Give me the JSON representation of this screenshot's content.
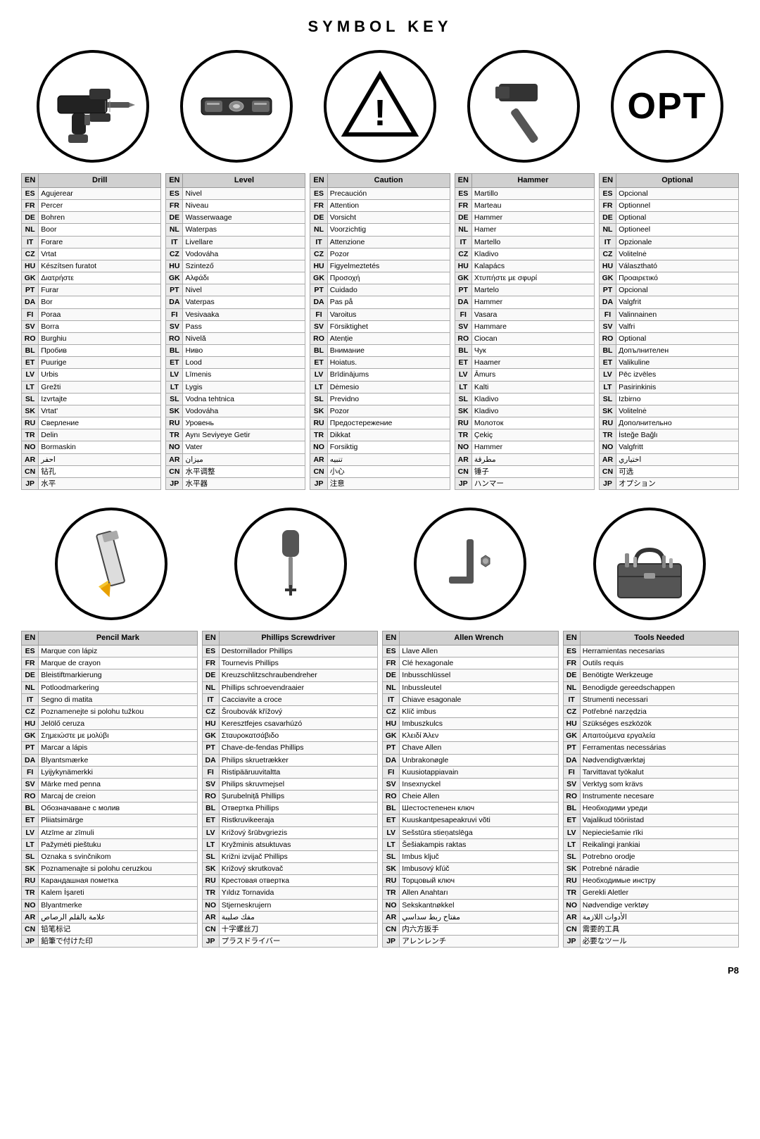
{
  "title": "SYMBOL KEY",
  "page_number": "P8",
  "icons_row1": [
    {
      "name": "Drill",
      "shape": "drill"
    },
    {
      "name": "Level",
      "shape": "level"
    },
    {
      "name": "Caution",
      "shape": "caution"
    },
    {
      "name": "Hammer",
      "shape": "hammer"
    },
    {
      "name": "Optional",
      "shape": "opt"
    }
  ],
  "icons_row2": [
    {
      "name": "Pencil Mark",
      "shape": "pencil"
    },
    {
      "name": "Phillips Screwdriver",
      "shape": "phillips"
    },
    {
      "name": "Allen Wrench",
      "shape": "allen"
    },
    {
      "name": "Tools Needed",
      "shape": "toolbox"
    }
  ],
  "tables": [
    {
      "id": "drill",
      "header": [
        "EN",
        "Drill"
      ],
      "rows": [
        [
          "ES",
          "Agujerear"
        ],
        [
          "FR",
          "Percer"
        ],
        [
          "DE",
          "Bohren"
        ],
        [
          "NL",
          "Boor"
        ],
        [
          "IT",
          "Forare"
        ],
        [
          "CZ",
          "Vrtat"
        ],
        [
          "HU",
          "Készítsen furatot"
        ],
        [
          "GK",
          "Διατρήστε"
        ],
        [
          "PT",
          "Furar"
        ],
        [
          "DA",
          "Bor"
        ],
        [
          "FI",
          "Poraa"
        ],
        [
          "SV",
          "Borra"
        ],
        [
          "RO",
          "Burghiu"
        ],
        [
          "BL",
          "Пробив"
        ],
        [
          "ET",
          "Puurige"
        ],
        [
          "LV",
          "Urbis"
        ],
        [
          "LT",
          "Grežti"
        ],
        [
          "SL",
          "Izvrtajte"
        ],
        [
          "SK",
          "Vrtat'"
        ],
        [
          "RU",
          "Сверление"
        ],
        [
          "TR",
          "Delin"
        ],
        [
          "NO",
          "Bormaskin"
        ],
        [
          "AR",
          "احفر"
        ],
        [
          "CN",
          "钻孔"
        ],
        [
          "JP",
          "水平"
        ]
      ]
    },
    {
      "id": "level",
      "header": [
        "EN",
        "Level"
      ],
      "rows": [
        [
          "ES",
          "Nivel"
        ],
        [
          "FR",
          "Niveau"
        ],
        [
          "DE",
          "Wasserwaage"
        ],
        [
          "NL",
          "Waterpas"
        ],
        [
          "IT",
          "Livellare"
        ],
        [
          "CZ",
          "Vodováha"
        ],
        [
          "HU",
          "Szintező"
        ],
        [
          "GK",
          "Αλφάδι"
        ],
        [
          "PT",
          "Nivel"
        ],
        [
          "DA",
          "Vaterpas"
        ],
        [
          "FI",
          "Vesivaaka"
        ],
        [
          "SV",
          "Pass"
        ],
        [
          "RO",
          "Nivelă"
        ],
        [
          "BL",
          "Ниво"
        ],
        [
          "ET",
          "Lood"
        ],
        [
          "LV",
          "Līmenis"
        ],
        [
          "LT",
          "Lygis"
        ],
        [
          "SL",
          "Vodna tehtnica"
        ],
        [
          "SK",
          "Vodováha"
        ],
        [
          "RU",
          "Уровень"
        ],
        [
          "TR",
          "Aynı Seviyeye Getir"
        ],
        [
          "NO",
          "Vater"
        ],
        [
          "AR",
          "ميزان"
        ],
        [
          "CN",
          "水平调整"
        ],
        [
          "JP",
          "水平器"
        ]
      ]
    },
    {
      "id": "caution",
      "header": [
        "EN",
        "Caution"
      ],
      "rows": [
        [
          "ES",
          "Precaución"
        ],
        [
          "FR",
          "Attention"
        ],
        [
          "DE",
          "Vorsicht"
        ],
        [
          "NL",
          "Voorzichtig"
        ],
        [
          "IT",
          "Attenzione"
        ],
        [
          "CZ",
          "Pozor"
        ],
        [
          "HU",
          "Figyelmeztetés"
        ],
        [
          "GK",
          "Προσοχή"
        ],
        [
          "PT",
          "Cuidado"
        ],
        [
          "DA",
          "Pas på"
        ],
        [
          "FI",
          "Varoitus"
        ],
        [
          "SV",
          "Försiktighet"
        ],
        [
          "RO",
          "Atenție"
        ],
        [
          "BL",
          "Внимание"
        ],
        [
          "ET",
          "Hoiatus."
        ],
        [
          "LV",
          "Brīdinājums"
        ],
        [
          "LT",
          "Dėmesio"
        ],
        [
          "SL",
          "Previdno"
        ],
        [
          "SK",
          "Pozor"
        ],
        [
          "RU",
          "Предостережение"
        ],
        [
          "TR",
          "Dikkat"
        ],
        [
          "NO",
          "Forsiktig"
        ],
        [
          "AR",
          "تنبيه"
        ],
        [
          "CN",
          "小心"
        ],
        [
          "JP",
          "注意"
        ]
      ]
    },
    {
      "id": "hammer",
      "header": [
        "EN",
        "Hammer"
      ],
      "rows": [
        [
          "ES",
          "Martillo"
        ],
        [
          "FR",
          "Marteau"
        ],
        [
          "DE",
          "Hammer"
        ],
        [
          "NL",
          "Hamer"
        ],
        [
          "IT",
          "Martello"
        ],
        [
          "CZ",
          "Kladivo"
        ],
        [
          "HU",
          "Kalapács"
        ],
        [
          "GK",
          "Χτυπήστε με σφυρί"
        ],
        [
          "PT",
          "Martelo"
        ],
        [
          "DA",
          "Hammer"
        ],
        [
          "FI",
          "Vasara"
        ],
        [
          "SV",
          "Hammare"
        ],
        [
          "RO",
          "Ciocan"
        ],
        [
          "BL",
          "Чук"
        ],
        [
          "ET",
          "Haamer"
        ],
        [
          "LV",
          "Āmurs"
        ],
        [
          "LT",
          "Kalti"
        ],
        [
          "SL",
          "Kladivo"
        ],
        [
          "SK",
          "Kladivo"
        ],
        [
          "RU",
          "Молоток"
        ],
        [
          "TR",
          "Çekiç"
        ],
        [
          "NO",
          "Hammer"
        ],
        [
          "AR",
          "مطرقة"
        ],
        [
          "CN",
          "锤子"
        ],
        [
          "JP",
          "ハンマー"
        ]
      ]
    },
    {
      "id": "optional",
      "header": [
        "EN",
        "Optional"
      ],
      "rows": [
        [
          "ES",
          "Opcional"
        ],
        [
          "FR",
          "Optionnel"
        ],
        [
          "DE",
          "Optional"
        ],
        [
          "NL",
          "Optioneel"
        ],
        [
          "IT",
          "Opzionale"
        ],
        [
          "CZ",
          "Volitelnė"
        ],
        [
          "HU",
          "Választható"
        ],
        [
          "GK",
          "Προαιρετικό"
        ],
        [
          "PT",
          "Opcional"
        ],
        [
          "DA",
          "Valgfrit"
        ],
        [
          "FI",
          "Valinnainen"
        ],
        [
          "SV",
          "Valfri"
        ],
        [
          "RO",
          "Optional"
        ],
        [
          "BL",
          "Допълнителен"
        ],
        [
          "ET",
          "Valikuline"
        ],
        [
          "LV",
          "Pēc izvēles"
        ],
        [
          "LT",
          "Pasirinkinis"
        ],
        [
          "SL",
          "Izbirno"
        ],
        [
          "SK",
          "Volitelnė"
        ],
        [
          "RU",
          "Дополнительно"
        ],
        [
          "TR",
          "İsteğe Bağlı"
        ],
        [
          "NO",
          "Valgfritt"
        ],
        [
          "AR",
          "اختياري"
        ],
        [
          "CN",
          "可选"
        ],
        [
          "JP",
          "オプション"
        ]
      ]
    },
    {
      "id": "pencil",
      "header": [
        "EN",
        "Pencil Mark"
      ],
      "rows": [
        [
          "ES",
          "Marque con lápiz"
        ],
        [
          "FR",
          "Marque de crayon"
        ],
        [
          "DE",
          "Bleistiftmarkierung"
        ],
        [
          "NL",
          "Potloodmarkering"
        ],
        [
          "IT",
          "Segno di matita"
        ],
        [
          "CZ",
          "Poznamenejte si polohu tužkou"
        ],
        [
          "HU",
          "Jelölő ceruza"
        ],
        [
          "GK",
          "Σημειώστε με μολύβι"
        ],
        [
          "PT",
          "Marcar a lápis"
        ],
        [
          "DA",
          "Blyantsmærke"
        ],
        [
          "FI",
          "Lyijykynämerkki"
        ],
        [
          "SV",
          "Märke med penna"
        ],
        [
          "RO",
          "Marcaj de creion"
        ],
        [
          "BL",
          "Обозначаване с молив"
        ],
        [
          "ET",
          "Pliiatsimärge"
        ],
        [
          "LV",
          "Atzīme ar zīmuli"
        ],
        [
          "LT",
          "Pažymėti pieštuku"
        ],
        [
          "SL",
          "Oznaka s svinčnikom"
        ],
        [
          "SK",
          "Poznamenajte si polohu ceruzkou"
        ],
        [
          "RU",
          "Карандашная пометка"
        ],
        [
          "TR",
          "Kalem İşareti"
        ],
        [
          "NO",
          "Blyantmerke"
        ],
        [
          "AR",
          "علامة بالقلم الرصاص"
        ],
        [
          "CN",
          "铅笔标记"
        ],
        [
          "JP",
          "鉛筆で付けた印"
        ]
      ]
    },
    {
      "id": "phillips",
      "header": [
        "EN",
        "Phillips Screwdriver"
      ],
      "rows": [
        [
          "ES",
          "Destornillador Phillips"
        ],
        [
          "FR",
          "Tournevis Phillips"
        ],
        [
          "DE",
          "Kreuzschlitzschraubendreher"
        ],
        [
          "NL",
          "Phillips schroevendraaier"
        ],
        [
          "IT",
          "Cacciavite a croce"
        ],
        [
          "CZ",
          "Šroubovák křížový"
        ],
        [
          "HU",
          "Keresztfejes csavarhúzó"
        ],
        [
          "GK",
          "Σταυροκατσάβιδο"
        ],
        [
          "PT",
          "Chave-de-fendas Phillips"
        ],
        [
          "DA",
          "Philips skruetrækker"
        ],
        [
          "FI",
          "Ristipääruuvitaltta"
        ],
        [
          "SV",
          "Philips skruvmejsel"
        ],
        [
          "RO",
          "Șurubelniță Phillips"
        ],
        [
          "BL",
          "Отвертка Phillips"
        ],
        [
          "ET",
          "Ristkruvikeeraja"
        ],
        [
          "LV",
          "Križový šrūbvgriezis"
        ],
        [
          "LT",
          "Kryžminis atsuktuvas"
        ],
        [
          "SL",
          "Križni izvijač Phillips"
        ],
        [
          "SK",
          "Križový skrutkovač"
        ],
        [
          "RU",
          "Крестовая отвертка"
        ],
        [
          "TR",
          "Yıldız Tornavida"
        ],
        [
          "NO",
          "Stjerneskrujern"
        ],
        [
          "AR",
          "مفك صليبة"
        ],
        [
          "CN",
          "十字螺丝刀"
        ],
        [
          "JP",
          "プラスドライバー"
        ]
      ]
    },
    {
      "id": "allen",
      "header": [
        "EN",
        "Allen Wrench"
      ],
      "rows": [
        [
          "ES",
          "Llave Allen"
        ],
        [
          "FR",
          "Clé hexagonale"
        ],
        [
          "DE",
          "Inbusschlüssel"
        ],
        [
          "NL",
          "Inbussleutel"
        ],
        [
          "IT",
          "Chiave esagonale"
        ],
        [
          "CZ",
          "Klíč imbus"
        ],
        [
          "HU",
          "Imbuszkulcs"
        ],
        [
          "GK",
          "Κλειδί Άλεν"
        ],
        [
          "PT",
          "Chave Allen"
        ],
        [
          "DA",
          "Unbrakonøgle"
        ],
        [
          "FI",
          "Kuusiotappiavain"
        ],
        [
          "SV",
          "Insexnyckel"
        ],
        [
          "RO",
          "Cheie Allen"
        ],
        [
          "BL",
          "Шестостепенен ключ"
        ],
        [
          "ET",
          "Kuuskantpesapeakruvi võti"
        ],
        [
          "LV",
          "Sešstūra stieņatslēga"
        ],
        [
          "LT",
          "Šešiakampis raktas"
        ],
        [
          "SL",
          "Imbus ključ"
        ],
        [
          "SK",
          "Imbusový kľúč"
        ],
        [
          "RU",
          "Торцовый ключ"
        ],
        [
          "TR",
          "Allen Anahtarı"
        ],
        [
          "NO",
          "Sekskantnøkkel"
        ],
        [
          "AR",
          "مفتاح ربط سداسي"
        ],
        [
          "CN",
          "内六方扳手"
        ],
        [
          "JP",
          "アレンレンチ"
        ]
      ]
    },
    {
      "id": "tools",
      "header": [
        "EN",
        "Tools Needed"
      ],
      "rows": [
        [
          "ES",
          "Herramientas necesarias"
        ],
        [
          "FR",
          "Outils requis"
        ],
        [
          "DE",
          "Benötigte Werkzeuge"
        ],
        [
          "NL",
          "Benodigde gereedschappen"
        ],
        [
          "IT",
          "Strumenti necessari"
        ],
        [
          "CZ",
          "Potřebné narzędzia"
        ],
        [
          "HU",
          "Szükséges eszközök"
        ],
        [
          "GK",
          "Απαιτούμενα εργαλεία"
        ],
        [
          "PT",
          "Ferramentas necessárias"
        ],
        [
          "DA",
          "Nødvendigtværktøj"
        ],
        [
          "FI",
          "Tarvittavat työkalut"
        ],
        [
          "SV",
          "Verktyg som krävs"
        ],
        [
          "RO",
          "Instrumente necesare"
        ],
        [
          "BL",
          "Необходими уреди"
        ],
        [
          "ET",
          "Vajalikud tööriistad"
        ],
        [
          "LV",
          "Nepieciešamie rīki"
        ],
        [
          "LT",
          "Reikalingi įrankiai"
        ],
        [
          "SL",
          "Potrebno orodje"
        ],
        [
          "SK",
          "Potrebné náradie"
        ],
        [
          "RU",
          "Необходимые инстру"
        ],
        [
          "TR",
          "Gerekli Aletler"
        ],
        [
          "NO",
          "Nødvendige verktøy"
        ],
        [
          "AR",
          "الأدوات اللازمة"
        ],
        [
          "CN",
          "需要的工具"
        ],
        [
          "JP",
          "必要なツール"
        ]
      ]
    }
  ]
}
